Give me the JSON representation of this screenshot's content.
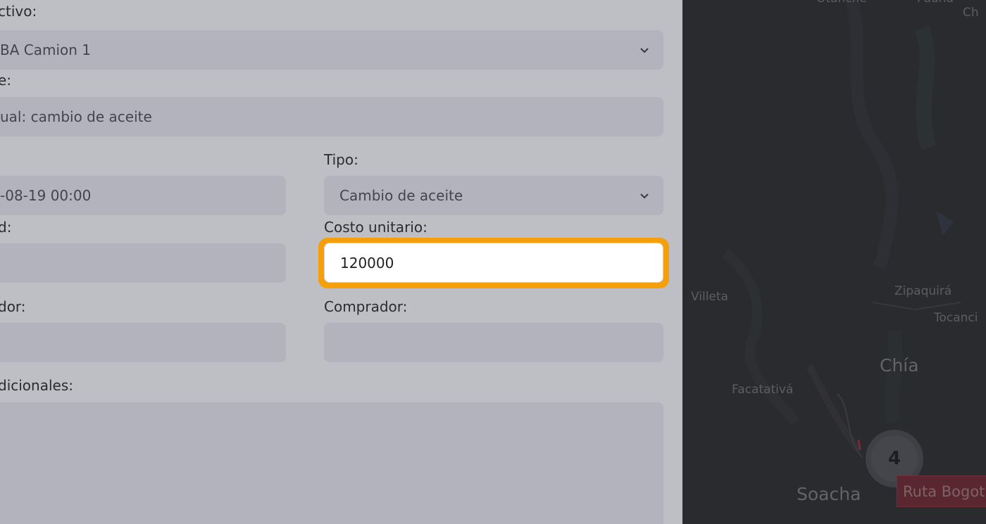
{
  "form": {
    "activo": {
      "label": "ctivo:",
      "value": "BA Camion 1"
    },
    "nombre": {
      "label": "e:",
      "value": "ual: cambio de aceite"
    },
    "fecha": {
      "value": "-08-19 00:00"
    },
    "tipo": {
      "label": "Tipo:",
      "value": "Cambio de aceite"
    },
    "cantidad": {
      "label": "d:",
      "value": ""
    },
    "costo_unitario": {
      "label": "Costo unitario:",
      "value": "120000"
    },
    "proveedor": {
      "label": "dor:",
      "value": ""
    },
    "comprador": {
      "label": "Comprador:",
      "value": ""
    },
    "notas": {
      "label": "dicionales:",
      "value": ""
    }
  },
  "map": {
    "towns": [
      "Otanche",
      "Pauna",
      "Ch",
      "Villeta",
      "Zipaquirá",
      "Tocanci",
      "Chía",
      "Facatativá",
      "Soacha"
    ],
    "cluster_count": "4",
    "route_label": "Ruta Bogot"
  },
  "colors": {
    "focus_ring": "#f59f0b",
    "panel_bg": "#bebfc4",
    "field_bg": "#b2b3bd",
    "map_bg": "#2a2b2f"
  }
}
